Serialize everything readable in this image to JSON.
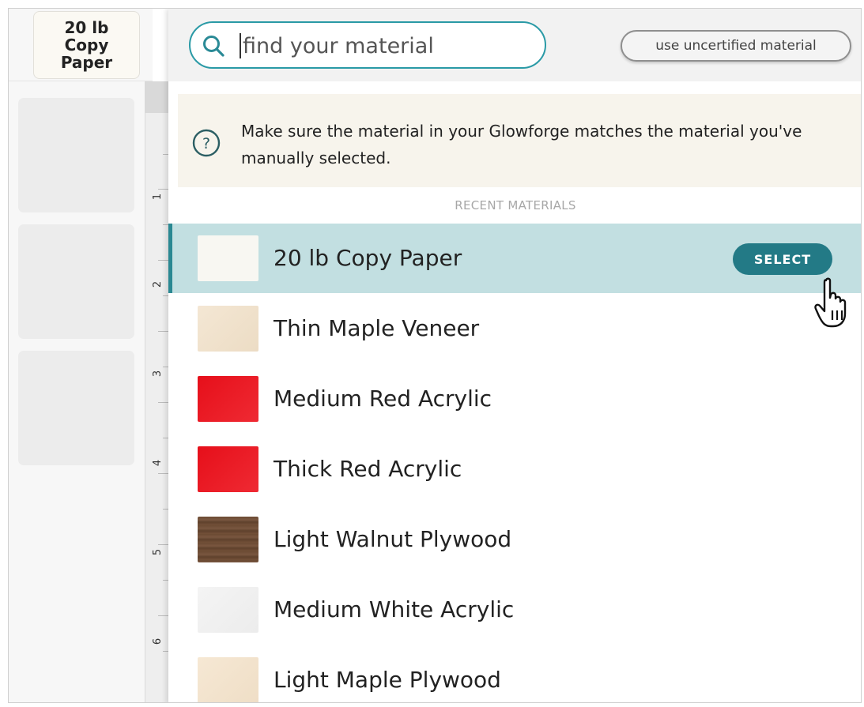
{
  "sidebar": {
    "current_material": "20 lb Copy Paper"
  },
  "ruler": {
    "numbers": [
      "1",
      "2",
      "3",
      "4",
      "5",
      "6"
    ]
  },
  "search": {
    "placeholder": "find your material",
    "icon": "search-icon"
  },
  "uncertified_button": "use uncertified material",
  "notice": {
    "icon": "question-circle-icon",
    "text": "Make sure the material in your Glowforge matches the material you've manually selected."
  },
  "section_label": "RECENT MATERIALS",
  "materials": [
    {
      "name": "20 lb Copy Paper",
      "color": "#f8f7f2",
      "selected": true
    },
    {
      "name": "Thin Maple Veneer",
      "color": "#f1e2cd"
    },
    {
      "name": "Medium Red Acrylic",
      "color": "#e8121d"
    },
    {
      "name": "Thick Red Acrylic",
      "color": "#e8121d"
    },
    {
      "name": "Light Walnut Plywood",
      "color": "#6e4d35"
    },
    {
      "name": "Medium White Acrylic",
      "color": "#f1f1f1"
    },
    {
      "name": "Light Maple Plywood",
      "color": "#f3e4cf"
    }
  ],
  "select_button": "SELECT",
  "colors": {
    "accent": "#237a86",
    "search_border": "#2a9aa6",
    "selected_row": "#c2dfe1"
  }
}
